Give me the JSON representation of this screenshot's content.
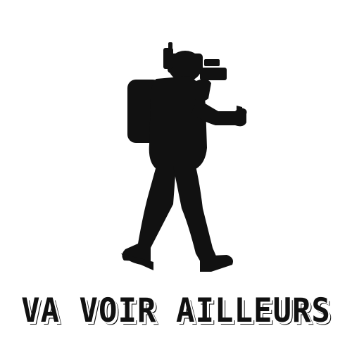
{
  "brand": {
    "name": "VA VOIR AILLEURS",
    "icon": "cameraman-walking-icon",
    "ink_color": "#111111",
    "background_color": "#ffffff"
  }
}
